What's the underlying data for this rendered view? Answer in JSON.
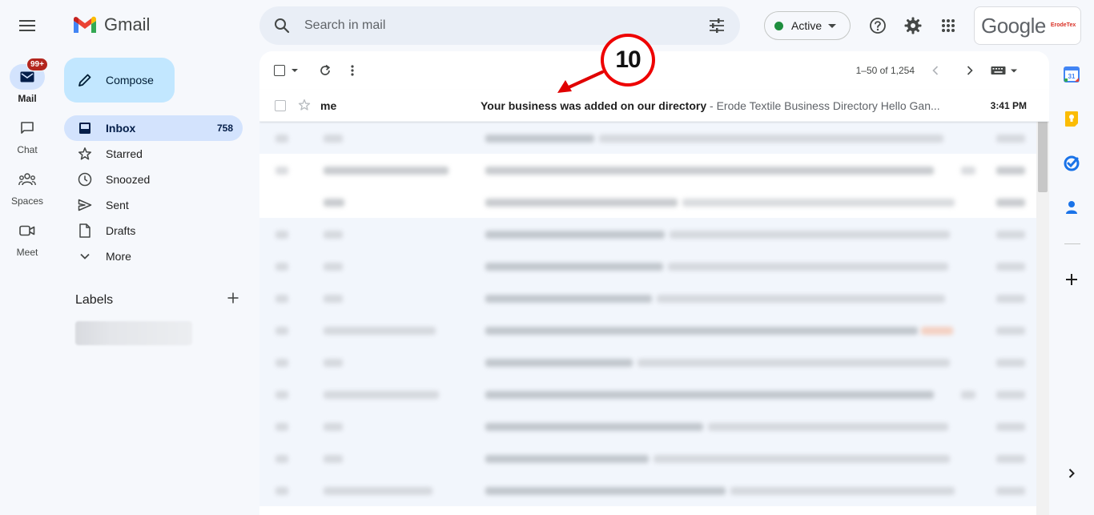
{
  "app": {
    "logo_text": "Gmail",
    "account_name": "Google",
    "account_logo_text": "ErodeTex"
  },
  "rail": {
    "items": [
      {
        "label": "Mail",
        "icon": "mail-icon",
        "badge": "99+"
      },
      {
        "label": "Chat",
        "icon": "chat-icon"
      },
      {
        "label": "Spaces",
        "icon": "spaces-icon"
      },
      {
        "label": "Meet",
        "icon": "meet-icon"
      }
    ]
  },
  "search": {
    "placeholder": "Search in mail"
  },
  "status": {
    "label": "Active",
    "color": "#1e8e3e"
  },
  "compose": {
    "label": "Compose"
  },
  "nav": {
    "items": [
      {
        "label": "Inbox",
        "count": "758",
        "icon": "inbox-icon"
      },
      {
        "label": "Starred",
        "icon": "star-icon"
      },
      {
        "label": "Snoozed",
        "icon": "clock-icon"
      },
      {
        "label": "Sent",
        "icon": "send-icon"
      },
      {
        "label": "Drafts",
        "icon": "draft-icon"
      },
      {
        "label": "More",
        "icon": "chevron-down-icon"
      }
    ],
    "labels_title": "Labels"
  },
  "toolbar": {
    "pager_text": "1–50 of 1,254"
  },
  "emails": [
    {
      "sender": "me",
      "subject": "Your business was added on our directory",
      "snippet": " - Erode Textile Business Directory Hello Gan...",
      "time": "3:41 PM"
    }
  ],
  "annotation": {
    "number": "10",
    "color": "#e00000"
  },
  "colors": {
    "accent": "#0b57d0",
    "nav_active_bg": "#d3e3fd",
    "compose_bg": "#c2e7ff",
    "badge_bg": "#b3261e"
  }
}
